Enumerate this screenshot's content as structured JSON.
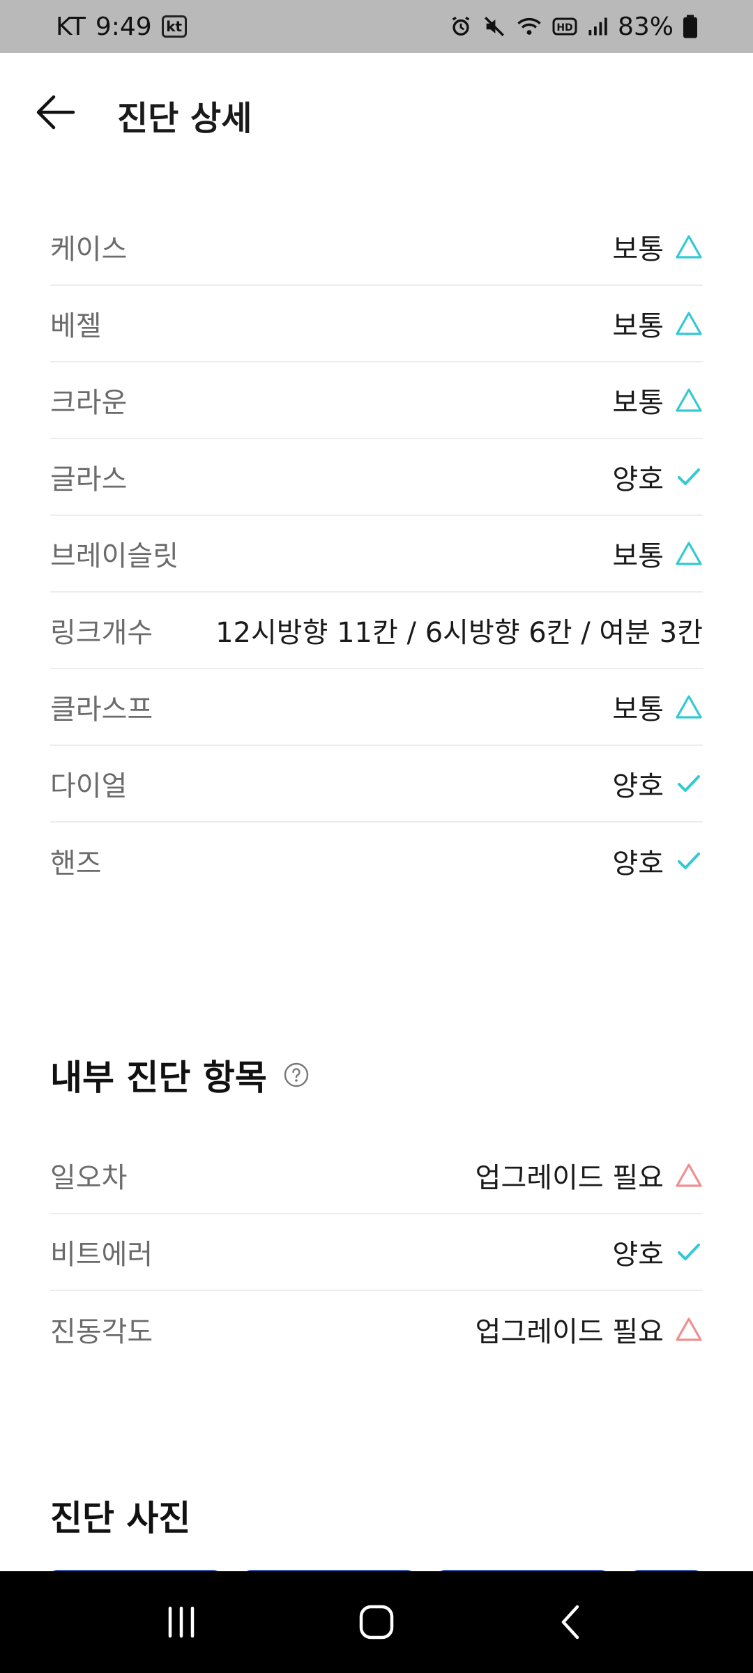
{
  "status_bar": {
    "carrier": "KT",
    "time": "9:49",
    "carrier_badge": "kt",
    "battery": "83%"
  },
  "header": {
    "title": "진단 상세"
  },
  "colors": {
    "ok": "#33c9d4",
    "normal": "#33c9d4",
    "warn": "#ef8f8f"
  },
  "exterior_items": [
    {
      "label": "케이스",
      "value": "보통",
      "status": "triangle-icon"
    },
    {
      "label": "베젤",
      "value": "보통",
      "status": "triangle-icon"
    },
    {
      "label": "크라운",
      "value": "보통",
      "status": "triangle-icon"
    },
    {
      "label": "글라스",
      "value": "양호",
      "status": "check-icon"
    },
    {
      "label": "브레이슬릿",
      "value": "보통",
      "status": "triangle-icon"
    },
    {
      "label": "링크개수",
      "value": "12시방향 11칸 / 6시방향 6칸 / 여분 3칸",
      "status": ""
    },
    {
      "label": "클라스프",
      "value": "보통",
      "status": "triangle-icon"
    },
    {
      "label": "다이얼",
      "value": "양호",
      "status": "check-icon"
    },
    {
      "label": "핸즈",
      "value": "양호",
      "status": "check-icon"
    }
  ],
  "internal_section": {
    "title": "내부 진단 항목"
  },
  "internal_items": [
    {
      "label": "일오차",
      "value": "업그레이드 필요",
      "status": "warning-triangle-icon"
    },
    {
      "label": "비트에러",
      "value": "양호",
      "status": "check-icon"
    },
    {
      "label": "진동각도",
      "value": "업그레이드 필요",
      "status": "warning-triangle-icon"
    }
  ],
  "photos_section": {
    "title": "진단 사진"
  }
}
